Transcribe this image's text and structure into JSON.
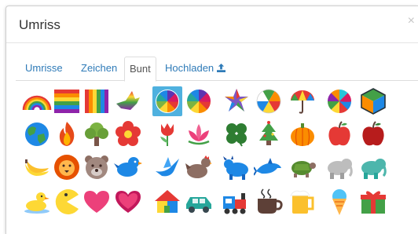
{
  "dialog": {
    "title": "Umriss",
    "close_label": "×"
  },
  "tabs": [
    {
      "label": "Umrisse",
      "active": false
    },
    {
      "label": "Zeichen",
      "active": false
    },
    {
      "label": "Bunt",
      "active": true
    },
    {
      "label": "Hochladen",
      "active": false,
      "icon": "upload-icon"
    }
  ],
  "shapes": [
    [
      "rainbow-arc-icon",
      "rainbow-stripes-icon",
      "rainbow-vertical-stripes-icon",
      "rainbow-dove-icon",
      "color-wheel-swirl-icon",
      "color-wheel-icon",
      "rainbow-star-icon",
      "beach-ball-icon",
      "umbrella-icon",
      "pinwheel-icon",
      "color-cube-icon"
    ],
    [
      "earth-icon",
      "fire-icon",
      "tree-icon",
      "red-flower-icon",
      "tulip-icon",
      "lotus-icon",
      "four-leaf-clover-icon",
      "christmas-tree-icon",
      "pumpkin-icon",
      "red-apple-icon",
      "dark-apple-icon"
    ],
    [
      "bananas-icon",
      "lion-icon",
      "bear-icon",
      "blue-bird-icon",
      "blue-dove-icon",
      "hen-icon",
      "blue-bull-icon",
      "dolphin-icon",
      "turtle-icon",
      "grey-elephant-icon",
      "teal-elephant-icon"
    ],
    [
      "duck-icon",
      "pacman-icon",
      "pink-heart-icon",
      "striped-heart-icon",
      "colorful-house-icon",
      "car-icon",
      "train-icon",
      "coffee-cup-icon",
      "beer-mug-icon",
      "ice-cream-icon",
      "gift-icon"
    ]
  ],
  "selected_shape": "color-wheel-swirl-icon"
}
